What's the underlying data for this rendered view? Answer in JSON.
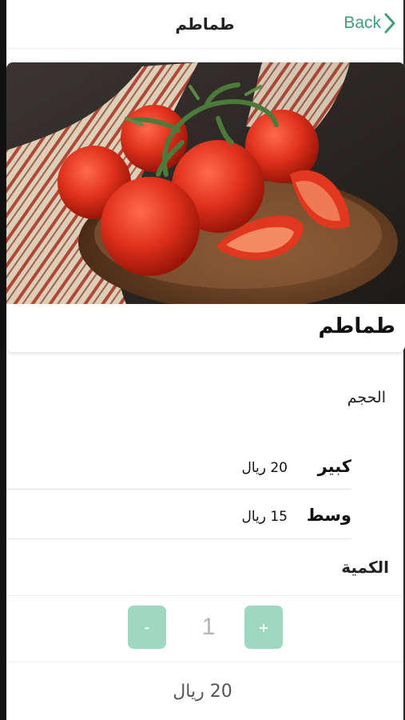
{
  "navbar": {
    "title": "طماطم",
    "back_label": "Back"
  },
  "product": {
    "name": "طماطم",
    "image_alt": "tomatoes-photo"
  },
  "size_section": {
    "title": "الحجم",
    "options": [
      {
        "label": "كبير",
        "price": "20 ريال"
      },
      {
        "label": "وسط",
        "price": "15 ريال"
      }
    ]
  },
  "quantity_section": {
    "title": "الكمية",
    "minus_label": "-",
    "plus_label": "+",
    "value": "1"
  },
  "total": "20 ريال",
  "colors": {
    "accent": "#3fa07a",
    "button": "#9fd8c2",
    "qty_text": "#b5b5b5"
  }
}
